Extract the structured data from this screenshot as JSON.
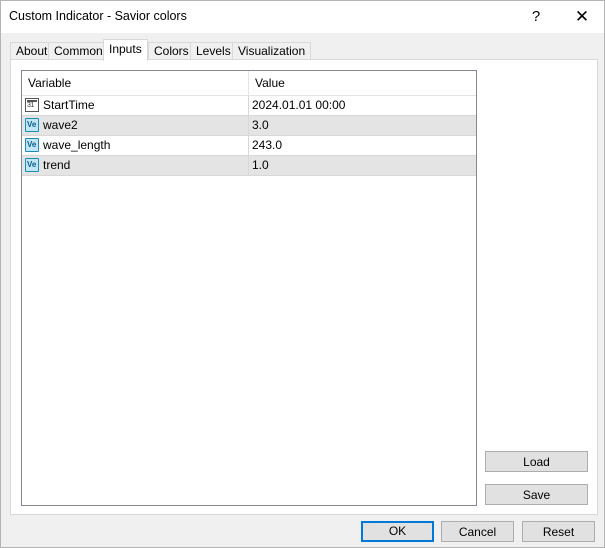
{
  "window": {
    "title": "Custom Indicator - Savior colors",
    "help_glyph": "?",
    "close_glyph": "✕"
  },
  "tabs": [
    {
      "label": "About"
    },
    {
      "label": "Common"
    },
    {
      "label": "Inputs",
      "active": true
    },
    {
      "label": "Colors"
    },
    {
      "label": "Levels"
    },
    {
      "label": "Visualization"
    }
  ],
  "grid": {
    "headers": {
      "variable": "Variable",
      "value": "Value"
    },
    "rows": [
      {
        "icon": "calendar-icon",
        "icon_text": "31",
        "variable": "StartTime",
        "value": "2024.01.01 00:00"
      },
      {
        "icon": "value-icon",
        "icon_text": "Ve",
        "variable": "wave2",
        "value": "3.0"
      },
      {
        "icon": "value-icon",
        "icon_text": "Ve",
        "variable": "wave_length",
        "value": "243.0"
      },
      {
        "icon": "value-icon",
        "icon_text": "Ve",
        "variable": "trend",
        "value": "1.0"
      }
    ]
  },
  "side_buttons": {
    "load": "Load",
    "save": "Save"
  },
  "footer": {
    "ok": "OK",
    "cancel": "Cancel",
    "reset": "Reset"
  },
  "colors": {
    "ok_border": "#0078d7",
    "icon_border": "#1e8bb8",
    "icon_fill": "#bfe7f7"
  }
}
